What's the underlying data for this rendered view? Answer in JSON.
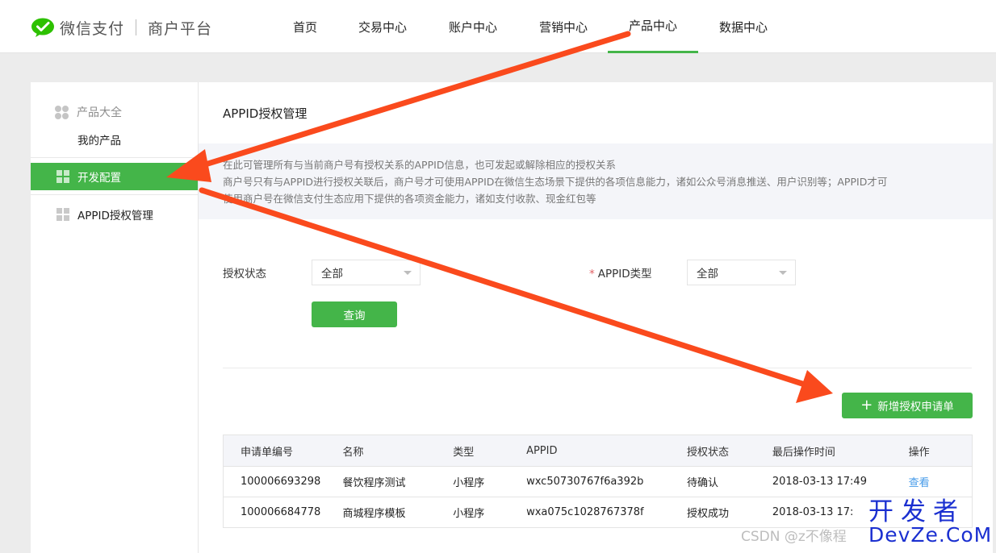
{
  "header": {
    "brand": "微信支付",
    "platform": "商户平台",
    "nav": [
      {
        "label": "首页",
        "active": false
      },
      {
        "label": "交易中心",
        "active": false
      },
      {
        "label": "账户中心",
        "active": false
      },
      {
        "label": "营销中心",
        "active": false
      },
      {
        "label": "产品中心",
        "active": true
      },
      {
        "label": "数据中心",
        "active": false
      }
    ]
  },
  "sidebar": {
    "group_label": "产品大全",
    "my_products": "我的产品",
    "items": [
      {
        "label": "开发配置",
        "active": true
      },
      {
        "label": "APPID授权管理",
        "active": false
      }
    ]
  },
  "main": {
    "title": "APPID授权管理",
    "notice": [
      "在此可管理所有与当前商户号有授权关系的APPID信息，也可发起或解除相应的授权关系",
      "商户号只有与APPID进行授权关联后，商户号才可使用APPID在微信生态场景下提供的各项信息能力，诸如公众号消息推送、用户识别等；APPID才可",
      "使用商户号在微信支付生态应用下提供的各项资金能力，诸如支付收款、现金红包等"
    ],
    "filters": {
      "status_label": "授权状态",
      "status_value": "全部",
      "type_required_mark": "*",
      "type_label": "APPID类型",
      "type_value": "全部",
      "query_button": "查询"
    },
    "add_button": "新增授权申请单",
    "table": {
      "headers": [
        "申请单编号",
        "名称",
        "类型",
        "APPID",
        "授权状态",
        "最后操作时间",
        "操作"
      ],
      "rows": [
        [
          "100006693298",
          "餐饮程序测试",
          "小程序",
          "wxc50730767f6a392b",
          "待确认",
          "2018-03-13 17:49",
          "查看"
        ],
        [
          "100006684778",
          "商城程序模板",
          "小程序",
          "wxa075c1028767378f",
          "授权成功",
          "2018-03-13 17:",
          ""
        ]
      ]
    }
  },
  "watermark": {
    "csdn": "CSDN @z不像程",
    "site_cn": "开发者",
    "site_en": "DevZe.CoM"
  },
  "colors": {
    "accent_green": "#44b549",
    "arrow": "#fa4a1d",
    "link": "#459ae9"
  }
}
